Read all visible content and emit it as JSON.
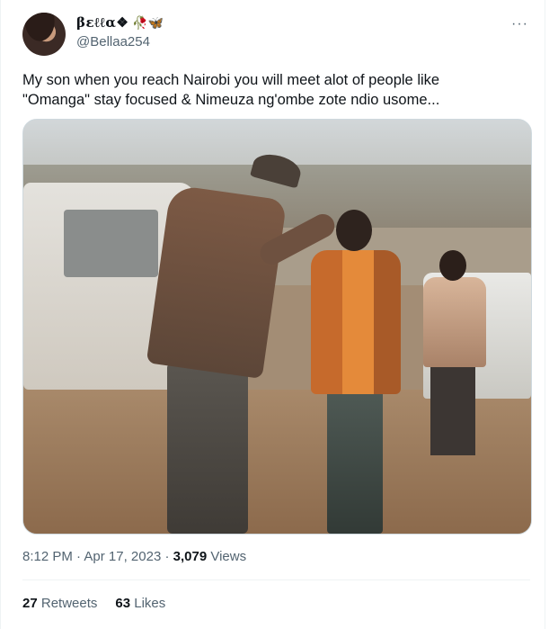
{
  "author": {
    "display_name": "βεℓℓα❖",
    "emoji": "🥀🦋",
    "handle": "@Bellaa254"
  },
  "more_label": "···",
  "tweet": {
    "text": "My son when you reach Nairobi you will meet alot of people like\n\"Omanga\" stay focused & Nimeuza ng'ombe zote ndio usome..."
  },
  "meta": {
    "time": "8:12 PM",
    "sep1": " · ",
    "date": "Apr 17, 2023",
    "sep2": " · ",
    "views_count": "3,079",
    "views_label": " Views"
  },
  "stats": {
    "retweets_count": "27",
    "retweets_label": "Retweets",
    "likes_count": "63",
    "likes_label": "Likes"
  }
}
